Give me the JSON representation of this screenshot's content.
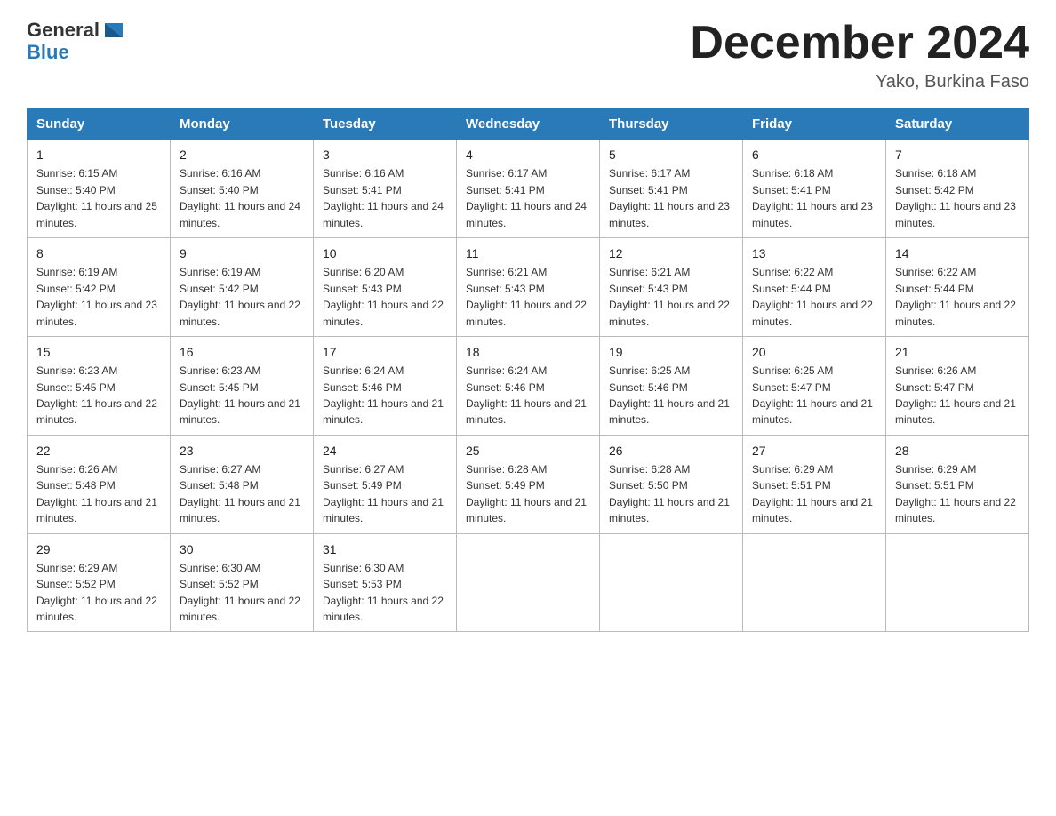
{
  "header": {
    "logo_general": "General",
    "logo_blue": "Blue",
    "title": "December 2024",
    "location": "Yako, Burkina Faso"
  },
  "days_of_week": [
    "Sunday",
    "Monday",
    "Tuesday",
    "Wednesday",
    "Thursday",
    "Friday",
    "Saturday"
  ],
  "weeks": [
    [
      {
        "day": "1",
        "sunrise": "6:15 AM",
        "sunset": "5:40 PM",
        "daylight": "11 hours and 25 minutes."
      },
      {
        "day": "2",
        "sunrise": "6:16 AM",
        "sunset": "5:40 PM",
        "daylight": "11 hours and 24 minutes."
      },
      {
        "day": "3",
        "sunrise": "6:16 AM",
        "sunset": "5:41 PM",
        "daylight": "11 hours and 24 minutes."
      },
      {
        "day": "4",
        "sunrise": "6:17 AM",
        "sunset": "5:41 PM",
        "daylight": "11 hours and 24 minutes."
      },
      {
        "day": "5",
        "sunrise": "6:17 AM",
        "sunset": "5:41 PM",
        "daylight": "11 hours and 23 minutes."
      },
      {
        "day": "6",
        "sunrise": "6:18 AM",
        "sunset": "5:41 PM",
        "daylight": "11 hours and 23 minutes."
      },
      {
        "day": "7",
        "sunrise": "6:18 AM",
        "sunset": "5:42 PM",
        "daylight": "11 hours and 23 minutes."
      }
    ],
    [
      {
        "day": "8",
        "sunrise": "6:19 AM",
        "sunset": "5:42 PM",
        "daylight": "11 hours and 23 minutes."
      },
      {
        "day": "9",
        "sunrise": "6:19 AM",
        "sunset": "5:42 PM",
        "daylight": "11 hours and 22 minutes."
      },
      {
        "day": "10",
        "sunrise": "6:20 AM",
        "sunset": "5:43 PM",
        "daylight": "11 hours and 22 minutes."
      },
      {
        "day": "11",
        "sunrise": "6:21 AM",
        "sunset": "5:43 PM",
        "daylight": "11 hours and 22 minutes."
      },
      {
        "day": "12",
        "sunrise": "6:21 AM",
        "sunset": "5:43 PM",
        "daylight": "11 hours and 22 minutes."
      },
      {
        "day": "13",
        "sunrise": "6:22 AM",
        "sunset": "5:44 PM",
        "daylight": "11 hours and 22 minutes."
      },
      {
        "day": "14",
        "sunrise": "6:22 AM",
        "sunset": "5:44 PM",
        "daylight": "11 hours and 22 minutes."
      }
    ],
    [
      {
        "day": "15",
        "sunrise": "6:23 AM",
        "sunset": "5:45 PM",
        "daylight": "11 hours and 22 minutes."
      },
      {
        "day": "16",
        "sunrise": "6:23 AM",
        "sunset": "5:45 PM",
        "daylight": "11 hours and 21 minutes."
      },
      {
        "day": "17",
        "sunrise": "6:24 AM",
        "sunset": "5:46 PM",
        "daylight": "11 hours and 21 minutes."
      },
      {
        "day": "18",
        "sunrise": "6:24 AM",
        "sunset": "5:46 PM",
        "daylight": "11 hours and 21 minutes."
      },
      {
        "day": "19",
        "sunrise": "6:25 AM",
        "sunset": "5:46 PM",
        "daylight": "11 hours and 21 minutes."
      },
      {
        "day": "20",
        "sunrise": "6:25 AM",
        "sunset": "5:47 PM",
        "daylight": "11 hours and 21 minutes."
      },
      {
        "day": "21",
        "sunrise": "6:26 AM",
        "sunset": "5:47 PM",
        "daylight": "11 hours and 21 minutes."
      }
    ],
    [
      {
        "day": "22",
        "sunrise": "6:26 AM",
        "sunset": "5:48 PM",
        "daylight": "11 hours and 21 minutes."
      },
      {
        "day": "23",
        "sunrise": "6:27 AM",
        "sunset": "5:48 PM",
        "daylight": "11 hours and 21 minutes."
      },
      {
        "day": "24",
        "sunrise": "6:27 AM",
        "sunset": "5:49 PM",
        "daylight": "11 hours and 21 minutes."
      },
      {
        "day": "25",
        "sunrise": "6:28 AM",
        "sunset": "5:49 PM",
        "daylight": "11 hours and 21 minutes."
      },
      {
        "day": "26",
        "sunrise": "6:28 AM",
        "sunset": "5:50 PM",
        "daylight": "11 hours and 21 minutes."
      },
      {
        "day": "27",
        "sunrise": "6:29 AM",
        "sunset": "5:51 PM",
        "daylight": "11 hours and 21 minutes."
      },
      {
        "day": "28",
        "sunrise": "6:29 AM",
        "sunset": "5:51 PM",
        "daylight": "11 hours and 22 minutes."
      }
    ],
    [
      {
        "day": "29",
        "sunrise": "6:29 AM",
        "sunset": "5:52 PM",
        "daylight": "11 hours and 22 minutes."
      },
      {
        "day": "30",
        "sunrise": "6:30 AM",
        "sunset": "5:52 PM",
        "daylight": "11 hours and 22 minutes."
      },
      {
        "day": "31",
        "sunrise": "6:30 AM",
        "sunset": "5:53 PM",
        "daylight": "11 hours and 22 minutes."
      },
      null,
      null,
      null,
      null
    ]
  ]
}
